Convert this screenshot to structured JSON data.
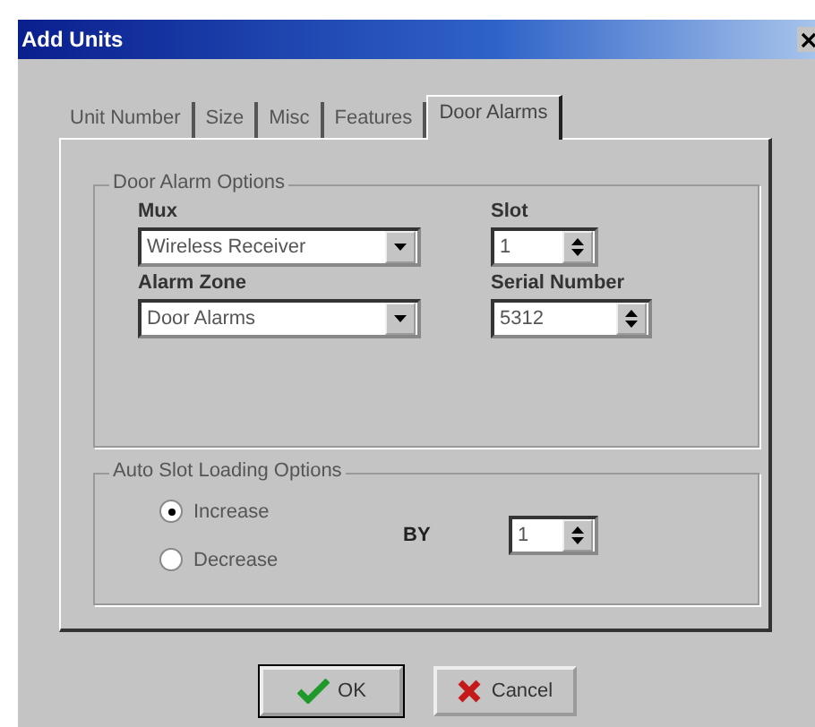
{
  "window": {
    "title": "Add Units"
  },
  "tabs": [
    {
      "label": "Unit Number",
      "selected": false
    },
    {
      "label": "Size",
      "selected": false
    },
    {
      "label": "Misc",
      "selected": false
    },
    {
      "label": "Features",
      "selected": false
    },
    {
      "label": "Door Alarms",
      "selected": true
    }
  ],
  "door_alarm_options": {
    "title": "Door Alarm Options",
    "mux": {
      "label": "Mux",
      "value": "Wireless Receiver"
    },
    "slot": {
      "label": "Slot",
      "value": "1"
    },
    "alarm_zone": {
      "label": "Alarm Zone",
      "value": "Door Alarms"
    },
    "serial_number": {
      "label": "Serial Number",
      "value": "5312"
    }
  },
  "auto_slot_loading_options": {
    "title": "Auto Slot Loading Options",
    "options": [
      {
        "label": "Increase",
        "selected": true
      },
      {
        "label": "Decrease",
        "selected": false
      }
    ],
    "by": {
      "label": "BY",
      "value": "1"
    }
  },
  "buttons": [
    {
      "label": "OK",
      "kind": "ok"
    },
    {
      "label": "Cancel",
      "kind": "cancel"
    }
  ]
}
